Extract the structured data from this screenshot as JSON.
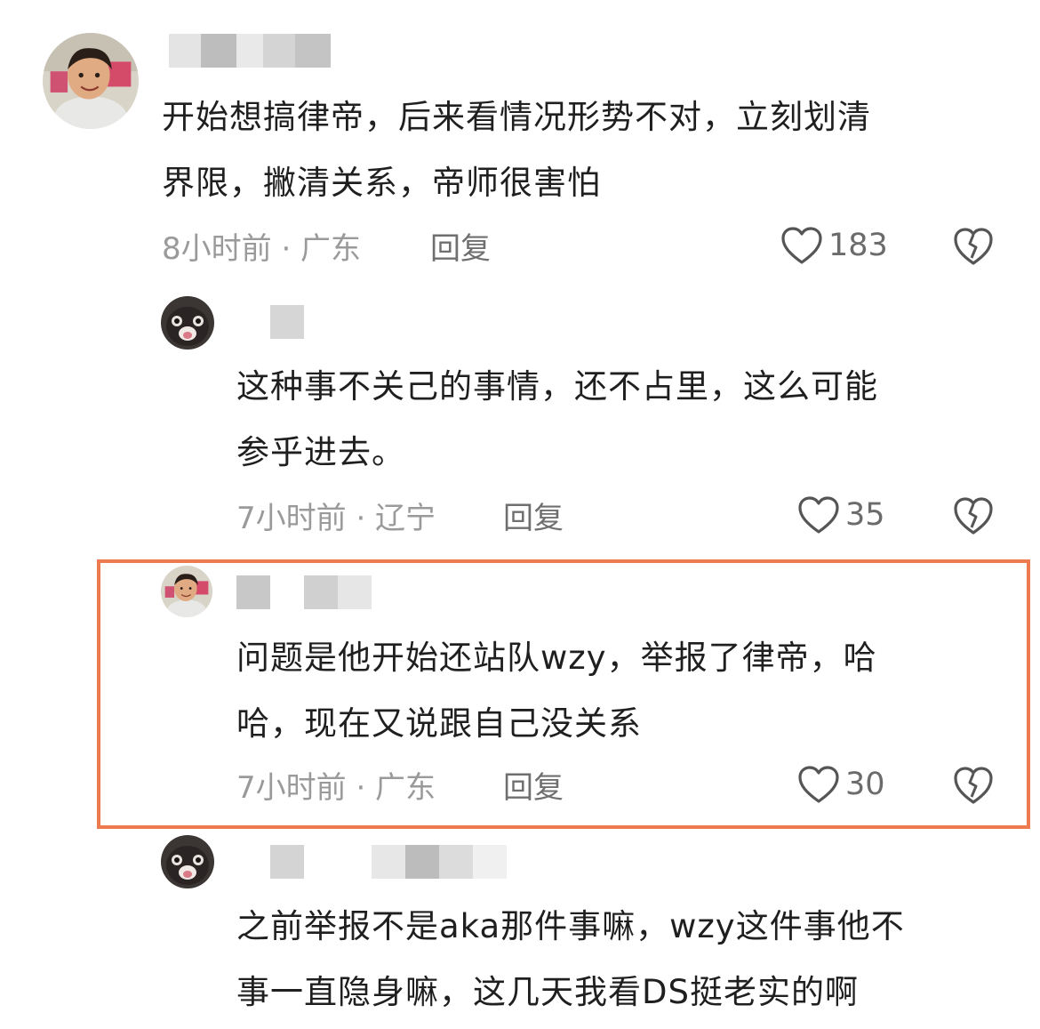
{
  "comments": [
    {
      "avatar": "boy-avatar",
      "text_lines": [
        "开始想搞律帝，后来看情况形势不对，立刻划清",
        "界限，撇清关系，帝师很害怕"
      ],
      "time_location": "8小时前 · 广东",
      "reply_label": "回复",
      "likes": "183"
    },
    {
      "avatar": "cat-avatar",
      "text_lines": [
        "这种事不关己的事情，还不占里，这么可能",
        "参乎进去。"
      ],
      "time_location": "7小时前 · 辽宁",
      "reply_label": "回复",
      "likes": "35"
    },
    {
      "avatar": "boy-avatar",
      "text_lines": [
        "问题是他开始还站队wzy，举报了律帝，哈",
        "哈，现在又说跟自己没关系"
      ],
      "time_location": "7小时前 · 广东",
      "reply_label": "回复",
      "likes": "30",
      "highlighted": true
    },
    {
      "avatar": "cat-avatar",
      "text_lines": [
        "之前举报不是aka那件事嘛，wzy这件事他不",
        "事一直隐身嘛，这几天我看DS挺老实的啊"
      ]
    }
  ],
  "colors": {
    "highlight_border": "#ee7a4f",
    "meta_text": "#9a9a9a",
    "body_text": "#1f1f1f"
  },
  "icons": {
    "like": "heart-outline-icon",
    "dislike": "broken-heart-icon"
  }
}
